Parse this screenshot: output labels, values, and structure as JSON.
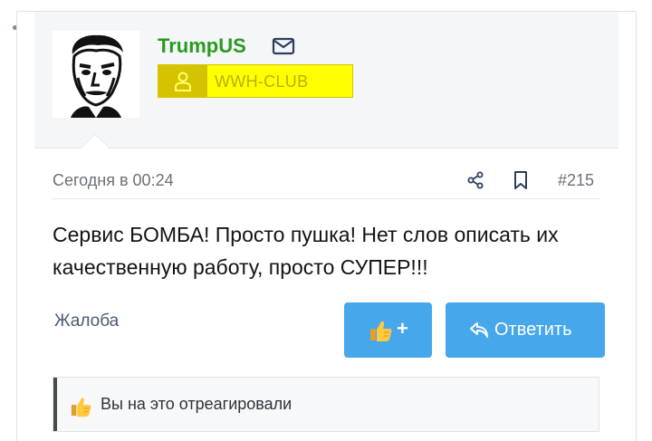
{
  "post": {
    "author": {
      "username": "TrumpUS",
      "usergroup": "WWH-CLUB",
      "avatar_icon": "portrait-avatar-icon",
      "username_color": "#2a9a1e",
      "usergroup_bg": "#ffff00"
    },
    "meta": {
      "time": "Сегодня в 00:24",
      "number": "#215"
    },
    "body": "Сервис БОМБА! Просто пушка! Нет слов описать их качественную работу, просто СУПЕР!!!",
    "actions": {
      "report_label": "Жалоба",
      "like_label": "+",
      "reply_label": "Ответить",
      "button_color": "#47a7eb"
    },
    "reactions": {
      "text": "Вы на это отреагировали"
    }
  }
}
